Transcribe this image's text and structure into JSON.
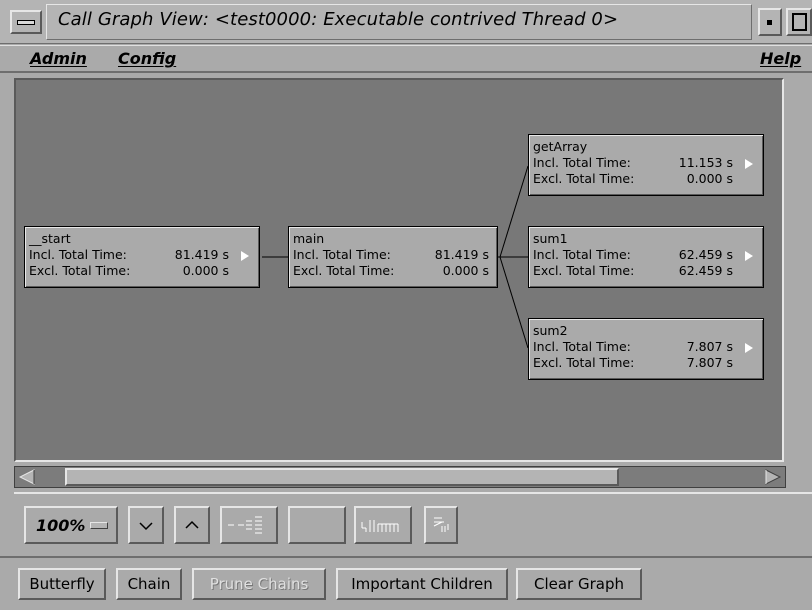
{
  "window": {
    "title": "Call Graph View: <test0000: Executable contrived Thread 0>"
  },
  "menubar": {
    "items": [
      "Admin",
      "Config"
    ],
    "help": "Help"
  },
  "graph": {
    "nodes": [
      {
        "name": "__start",
        "incl_label": "Incl. Total Time:",
        "incl_value": "81.419 s",
        "excl_label": "Excl. Total Time:",
        "excl_value": "0.000 s"
      },
      {
        "name": "main",
        "incl_label": "Incl. Total Time:",
        "incl_value": "81.419 s",
        "excl_label": "Excl. Total Time:",
        "excl_value": "0.000 s"
      },
      {
        "name": "getArray",
        "incl_label": "Incl. Total Time:",
        "incl_value": "11.153 s",
        "excl_label": "Excl. Total Time:",
        "excl_value": "0.000 s"
      },
      {
        "name": "sum1",
        "incl_label": "Incl. Total Time:",
        "incl_value": "62.459 s",
        "excl_label": "Excl. Total Time:",
        "excl_value": "62.459 s"
      },
      {
        "name": "sum2",
        "incl_label": "Incl. Total Time:",
        "incl_value": "7.807 s",
        "excl_label": "Excl. Total Time:",
        "excl_value": "7.807 s"
      }
    ],
    "edges": [
      [
        "__start",
        "main"
      ],
      [
        "main",
        "getArray"
      ],
      [
        "main",
        "sum1"
      ],
      [
        "main",
        "sum2"
      ]
    ]
  },
  "toolbar": {
    "zoom_value": "100%"
  },
  "buttons": {
    "butterfly": "Butterfly",
    "chain": "Chain",
    "prune_chains": "Prune Chains",
    "important_children": "Important Children",
    "clear_graph": "Clear Graph"
  }
}
